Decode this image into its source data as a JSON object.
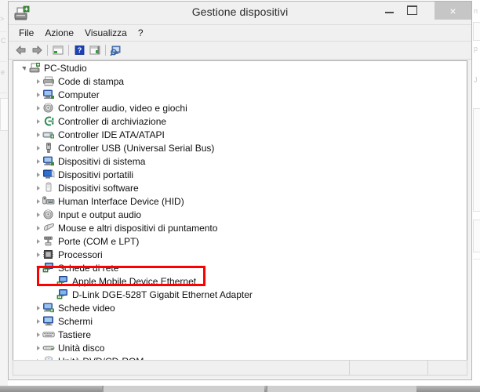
{
  "window": {
    "title": "Gestione dispositivi",
    "icon": "device-manager-icon",
    "buttons": {
      "minimize": "–",
      "maximize": "□",
      "close": "×"
    }
  },
  "menubar": {
    "items": [
      {
        "label": "File",
        "name": "menu-file"
      },
      {
        "label": "Azione",
        "name": "menu-azione"
      },
      {
        "label": "Visualizza",
        "name": "menu-visualizza"
      },
      {
        "label": "?",
        "name": "menu-help"
      }
    ]
  },
  "toolbar": {
    "items": [
      {
        "name": "back-button",
        "icon": "back-arrow-icon",
        "label": ""
      },
      {
        "name": "forward-button",
        "icon": "forward-arrow-icon",
        "label": ""
      },
      {
        "name": "properties-button",
        "icon": "properties-icon",
        "label": ""
      },
      {
        "name": "help-button",
        "icon": "help-question-icon",
        "label": ""
      },
      {
        "name": "scan-button",
        "icon": "scan-hardware-icon",
        "label": ""
      },
      {
        "name": "update-driver-button",
        "icon": "update-driver-icon",
        "label": ""
      }
    ]
  },
  "tree": {
    "root": {
      "label": "PC-Studio",
      "icon": "computer-root-icon",
      "expanded": true
    },
    "items": [
      {
        "label": "Code di stampa",
        "icon": "printer-icon",
        "expanded": false,
        "depth": 1
      },
      {
        "label": "Computer",
        "icon": "computer-icon",
        "expanded": false,
        "depth": 1
      },
      {
        "label": "Controller audio, video e giochi",
        "icon": "audio-icon",
        "expanded": false,
        "depth": 1
      },
      {
        "label": "Controller di archiviazione",
        "icon": "storage-controller-icon",
        "expanded": false,
        "depth": 1
      },
      {
        "label": "Controller IDE ATA/ATAPI",
        "icon": "ide-controller-icon",
        "expanded": false,
        "depth": 1
      },
      {
        "label": "Controller USB (Universal Serial Bus)",
        "icon": "usb-icon",
        "expanded": false,
        "depth": 1
      },
      {
        "label": "Dispositivi di sistema",
        "icon": "system-device-icon",
        "expanded": false,
        "depth": 1
      },
      {
        "label": "Dispositivi portatili",
        "icon": "portable-device-icon",
        "expanded": false,
        "depth": 1
      },
      {
        "label": "Dispositivi software",
        "icon": "software-device-icon",
        "expanded": false,
        "depth": 1
      },
      {
        "label": "Human Interface Device (HID)",
        "icon": "hid-icon",
        "expanded": false,
        "depth": 1
      },
      {
        "label": "Input e output audio",
        "icon": "audio-io-icon",
        "expanded": false,
        "depth": 1
      },
      {
        "label": "Mouse e altri dispositivi di puntamento",
        "icon": "mouse-icon",
        "expanded": false,
        "depth": 1
      },
      {
        "label": "Porte (COM e LPT)",
        "icon": "ports-icon",
        "expanded": false,
        "depth": 1
      },
      {
        "label": "Processori",
        "icon": "processor-icon",
        "expanded": false,
        "depth": 1
      },
      {
        "label": "Schede di rete",
        "icon": "network-adapter-icon",
        "expanded": true,
        "depth": 1
      },
      {
        "label": "Apple Mobile Device Ethernet",
        "icon": "network-device-icon",
        "expanded": null,
        "depth": 2,
        "highlighted": true
      },
      {
        "label": "D-Link DGE-528T Gigabit Ethernet Adapter",
        "icon": "network-device-icon",
        "expanded": null,
        "depth": 2
      },
      {
        "label": "Schede video",
        "icon": "display-adapter-icon",
        "expanded": false,
        "depth": 1
      },
      {
        "label": "Schermi",
        "icon": "monitor-icon",
        "expanded": false,
        "depth": 1
      },
      {
        "label": "Tastiere",
        "icon": "keyboard-icon",
        "expanded": false,
        "depth": 1
      },
      {
        "label": "Unità disco",
        "icon": "disk-drive-icon",
        "expanded": false,
        "depth": 1
      },
      {
        "label": "Unità DVD/CD-ROM",
        "icon": "dvd-drive-icon",
        "expanded": false,
        "depth": 1
      }
    ]
  },
  "annotation": {
    "color": "#ff0000",
    "target": "Apple Mobile Device Ethernet"
  },
  "statusbar": {
    "panel1": "",
    "panel2": "",
    "panel3": ""
  }
}
